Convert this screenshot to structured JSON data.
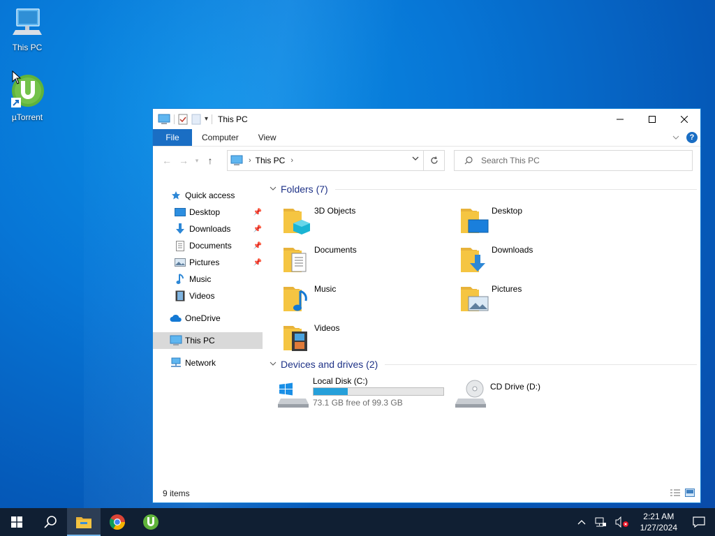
{
  "desktop": {
    "icons": [
      {
        "label": "This PC"
      },
      {
        "label": "µTorrent"
      }
    ]
  },
  "window": {
    "title": "This PC",
    "ribbon": {
      "tabs": [
        "File",
        "Computer",
        "View"
      ],
      "help": "?"
    },
    "address": {
      "crumb": "This PC"
    },
    "search": {
      "placeholder": "Search This PC"
    },
    "nav_pane": {
      "quick_access": "Quick access",
      "quick_items": [
        {
          "label": "Desktop",
          "pinned": true
        },
        {
          "label": "Downloads",
          "pinned": true
        },
        {
          "label": "Documents",
          "pinned": true
        },
        {
          "label": "Pictures",
          "pinned": true
        },
        {
          "label": "Music",
          "pinned": false
        },
        {
          "label": "Videos",
          "pinned": false
        }
      ],
      "onedrive": "OneDrive",
      "this_pc": "This PC",
      "network": "Network"
    },
    "folders_group": "Folders (7)",
    "folders": [
      {
        "label": "3D Objects"
      },
      {
        "label": "Desktop"
      },
      {
        "label": "Documents"
      },
      {
        "label": "Downloads"
      },
      {
        "label": "Music"
      },
      {
        "label": "Pictures"
      },
      {
        "label": "Videos"
      }
    ],
    "drives_group": "Devices and drives (2)",
    "drives": [
      {
        "label": "Local Disk (C:)",
        "free_text": "73.1 GB free of 99.3 GB",
        "used_fraction": 0.264
      },
      {
        "label": "CD Drive (D:)"
      }
    ],
    "status": "9 items"
  },
  "taskbar": {
    "time": "2:21 AM",
    "date": "1/27/2024"
  },
  "colors": {
    "accent": "#1a6ec4",
    "taskbar": "#101f33",
    "folder": "#f5c542",
    "disk_bar": "#26a0da"
  }
}
